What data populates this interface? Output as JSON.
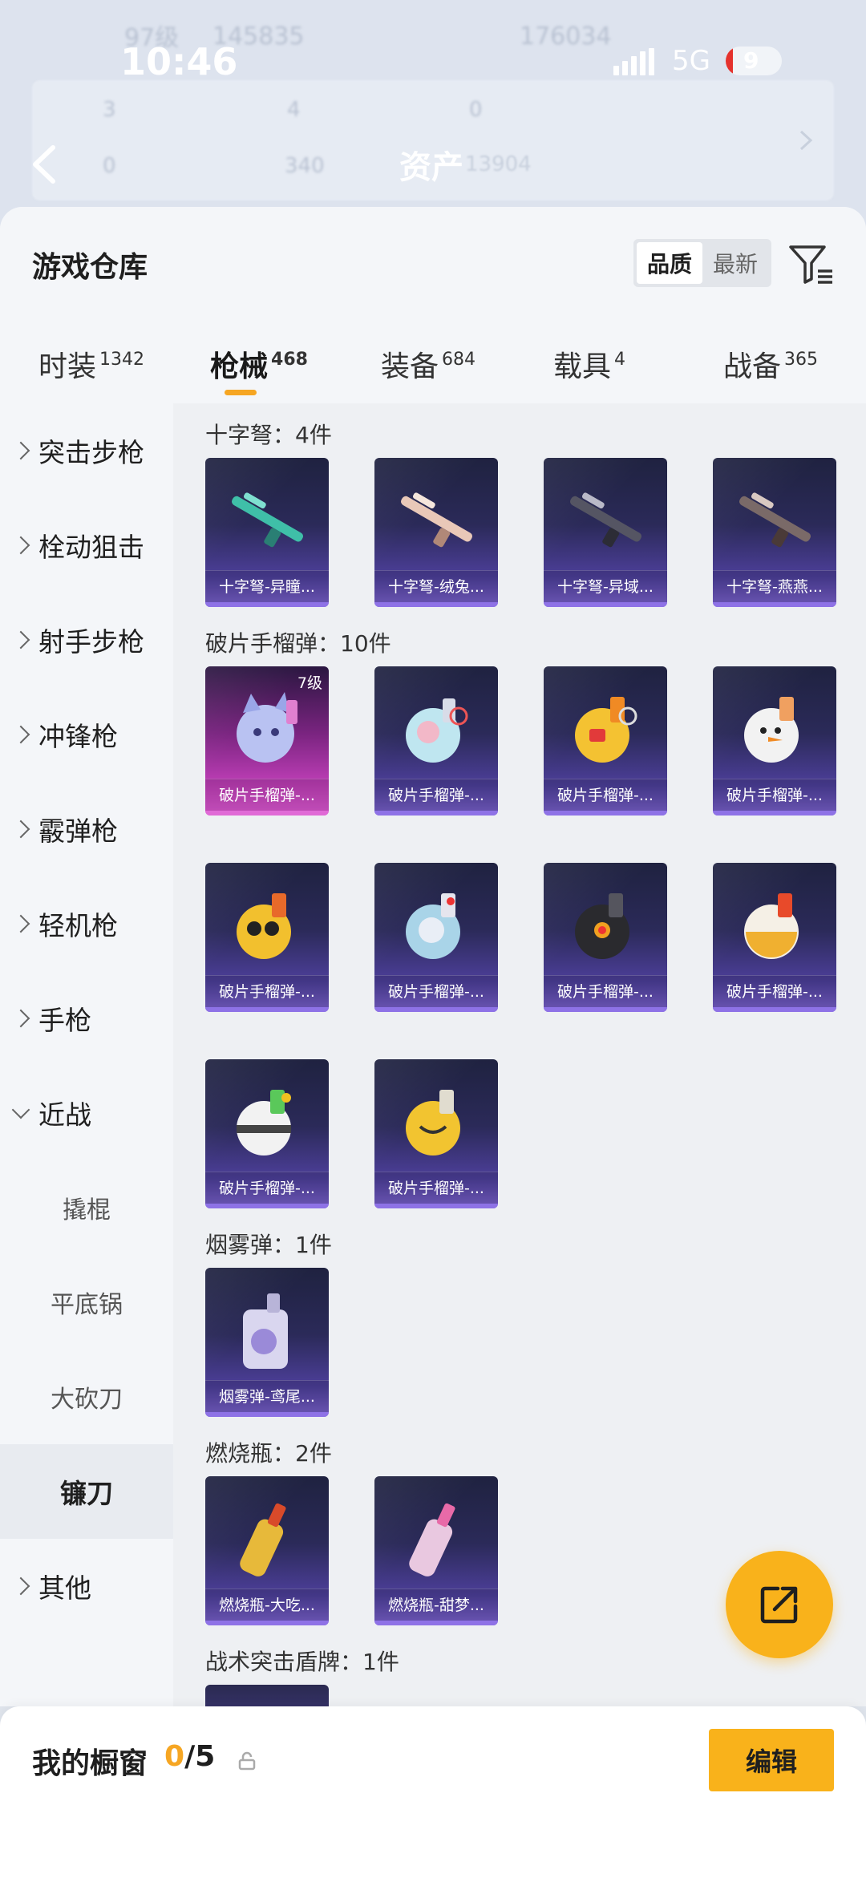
{
  "status_bar": {
    "time": "10:46",
    "network": "5G",
    "battery": "9"
  },
  "header_ghost": {
    "level": "97级",
    "score1": "145835",
    "score2": "176034",
    "assets_label": "资产",
    "assets_value": "13904",
    "stats": [
      "3",
      "4",
      "0",
      "0",
      "340"
    ]
  },
  "warehouse": {
    "title": "游戏仓库",
    "sort_options": [
      "品质",
      "最新"
    ],
    "tabs": [
      {
        "label": "时装",
        "count": "1342"
      },
      {
        "label": "枪械",
        "count": "468"
      },
      {
        "label": "装备",
        "count": "684"
      },
      {
        "label": "载具",
        "count": "4"
      },
      {
        "label": "战备",
        "count": "365"
      }
    ],
    "categories": [
      "突击步枪",
      "栓动狙击",
      "射手步枪",
      "冲锋枪",
      "霰弹枪",
      "轻机枪",
      "手枪",
      "近战"
    ],
    "melee_subs": [
      "撬棍",
      "平底锅",
      "大砍刀",
      "镰刀"
    ],
    "last_category": "其他"
  },
  "groups": [
    {
      "title": "十字弩：4件",
      "items": [
        "十字弩-异瞳...",
        "十字弩-绒兔...",
        "十字弩-异域...",
        "十字弩-燕燕..."
      ]
    },
    {
      "title": "破片手榴弹：10件",
      "level": "7级",
      "items": [
        "破片手榴弹-...",
        "破片手榴弹-...",
        "破片手榴弹-...",
        "破片手榴弹-...",
        "破片手榴弹-...",
        "破片手榴弹-...",
        "破片手榴弹-...",
        "破片手榴弹-...",
        "破片手榴弹-...",
        "破片手榴弹-..."
      ]
    },
    {
      "title": "烟雾弹：1件",
      "items": [
        "烟雾弹-鸢尾..."
      ]
    },
    {
      "title": "燃烧瓶：2件",
      "items": [
        "燃烧瓶-大吃...",
        "燃烧瓶-甜梦..."
      ]
    },
    {
      "title": "战术突击盾牌：1件"
    }
  ],
  "showcase": {
    "title": "我的橱窗",
    "current": "0",
    "total": "/5",
    "edit": "编辑"
  },
  "colors": {
    "accent": "#f9b21b",
    "tab_underline": "#f6a623",
    "rarity_purple": "#8e72e6",
    "rarity_pink": "#e06ad6"
  }
}
